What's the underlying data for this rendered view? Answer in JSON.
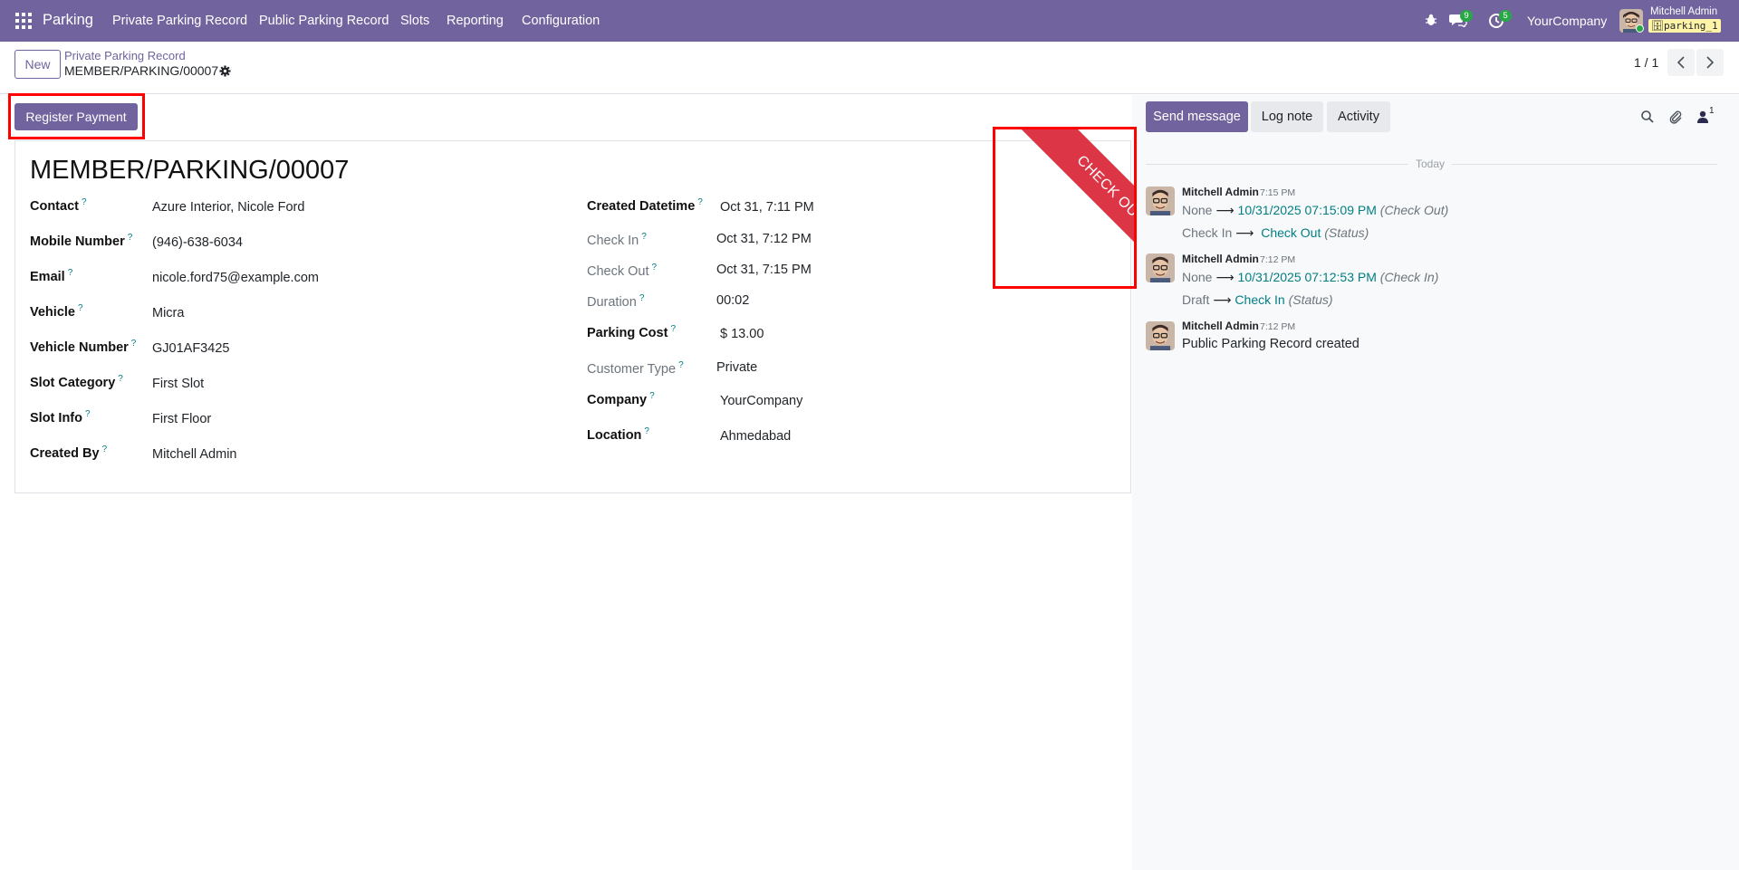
{
  "navbar": {
    "app_name": "Parking",
    "menus": [
      "Private Parking Record",
      "Public Parking Record",
      "Slots",
      "Reporting",
      "Configuration"
    ],
    "messages_badge": "9",
    "activities_badge": "5",
    "company": "YourCompany",
    "user_name": "Mitchell Admin",
    "database": "parking_1",
    "accent_color": "#71639e"
  },
  "control_panel": {
    "new_label": "New",
    "breadcrumb_parent": "Private Parking Record",
    "breadcrumb_current": "MEMBER/PARKING/00007",
    "pager": "1 / 1"
  },
  "form": {
    "register_payment_label": "Register Payment",
    "title": "MEMBER/PARKING/00007",
    "ribbon": "CHECK OUT",
    "left_fields": [
      {
        "label": "Contact",
        "value": "Azure Interior, Nicole Ford"
      },
      {
        "label": "Mobile Number",
        "value": "(946)-638-6034"
      },
      {
        "label": "Email",
        "value": "nicole.ford75@example.com"
      },
      {
        "label": "Vehicle",
        "value": "Micra"
      },
      {
        "label": "Vehicle Number",
        "value": "GJ01AF3425"
      },
      {
        "label": "Slot Category",
        "value": "First Slot"
      },
      {
        "label": "Slot Info",
        "value": "First Floor"
      },
      {
        "label": "Created By",
        "value": "Mitchell Admin"
      }
    ],
    "right_fields": [
      {
        "label": "Created Datetime",
        "value": "Oct 31, 7:11 PM"
      },
      {
        "label": "Check In",
        "value": "Oct 31, 7:12 PM"
      },
      {
        "label": "Check Out",
        "value": "Oct 31, 7:15 PM"
      },
      {
        "label": "Duration",
        "value": "00:02"
      },
      {
        "label": "Parking Cost",
        "value": "$ 13.00"
      },
      {
        "label": "Customer Type",
        "value": "Private"
      },
      {
        "label": "Company",
        "value": "YourCompany"
      },
      {
        "label": "Location",
        "value": "Ahmedabad"
      }
    ],
    "help_mark": "?"
  },
  "chatter": {
    "send_message_label": "Send message",
    "log_note_label": "Log note",
    "activity_label": "Activity",
    "followers_count": "1",
    "date_separator": "Today",
    "messages": [
      {
        "author": "Mitchell Admin",
        "time": "7:15 PM",
        "changes": [
          {
            "old": "None",
            "new": "10/31/2025 07:15:09 PM",
            "field": "(Check Out)"
          },
          {
            "old": "Check In",
            "new": "Check Out",
            "field": "(Status)"
          }
        ]
      },
      {
        "author": "Mitchell Admin",
        "time": "7:12 PM",
        "changes": [
          {
            "old": "None",
            "new": "10/31/2025 07:12:53 PM",
            "field": "(Check In)"
          },
          {
            "old": "Draft",
            "new": "Check In",
            "field": "(Status)"
          }
        ]
      },
      {
        "author": "Mitchell Admin",
        "time": "7:12 PM",
        "body": "Public Parking Record created"
      }
    ]
  }
}
